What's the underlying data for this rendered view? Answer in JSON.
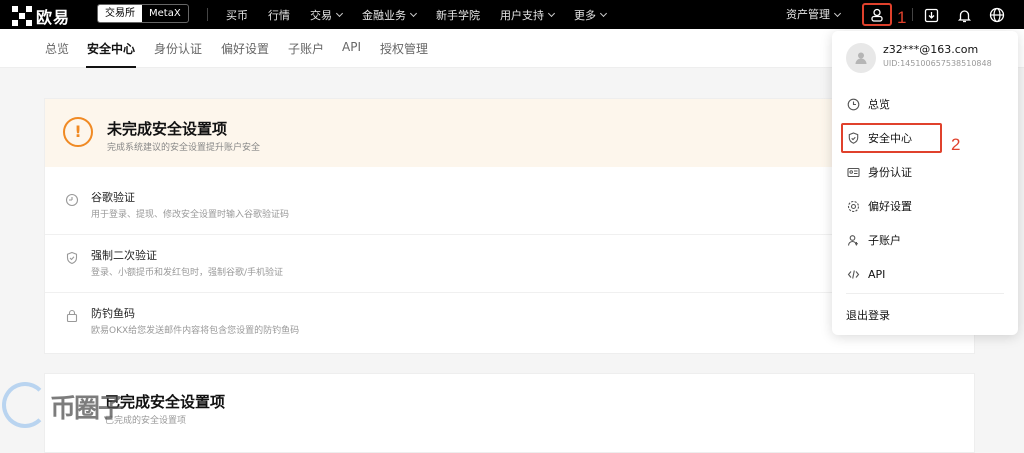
{
  "brand": {
    "name": "欧易"
  },
  "exchange_toggle": {
    "exchange": "交易所",
    "metax": "MetaX"
  },
  "nav": {
    "buy": "买币",
    "market": "行情",
    "trade": "交易",
    "finance": "金融业务",
    "academy": "新手学院",
    "support": "用户支持",
    "more": "更多"
  },
  "header_right": {
    "assets": "资产管理"
  },
  "annotations": {
    "one": "1",
    "two": "2"
  },
  "tabs": [
    "总览",
    "安全中心",
    "身份认证",
    "偏好设置",
    "子账户",
    "API",
    "授权管理"
  ],
  "security_card": {
    "title": "未完成安全设置项",
    "subtitle": "完成系统建议的安全设置提升账户安全",
    "icon_glyph": "!",
    "items": [
      {
        "title": "谷歌验证",
        "desc": "用于登录、提现、修改安全设置时输入谷歌验证码"
      },
      {
        "title": "强制二次验证",
        "desc": "登录、小额提币和发红包时，强制谷歌/手机验证"
      },
      {
        "title": "防钓鱼码",
        "desc": "欧易OKX给您发送邮件内容将包含您设置的防钓鱼码"
      }
    ]
  },
  "second_card": {
    "title": "已完成安全设置项",
    "subtitle": "已完成的安全设置项"
  },
  "watermark": {
    "text": "币圈子"
  },
  "dropdown": {
    "email": "z32***@163.com",
    "uid": "UID:145100657538510848",
    "items": [
      "总览",
      "安全中心",
      "身份认证",
      "偏好设置",
      "子账户",
      "API"
    ],
    "logout": "退出登录"
  },
  "colors": {
    "accent_red": "#e0412c",
    "warning_orange": "#f08a24",
    "topbar": "#000000"
  }
}
